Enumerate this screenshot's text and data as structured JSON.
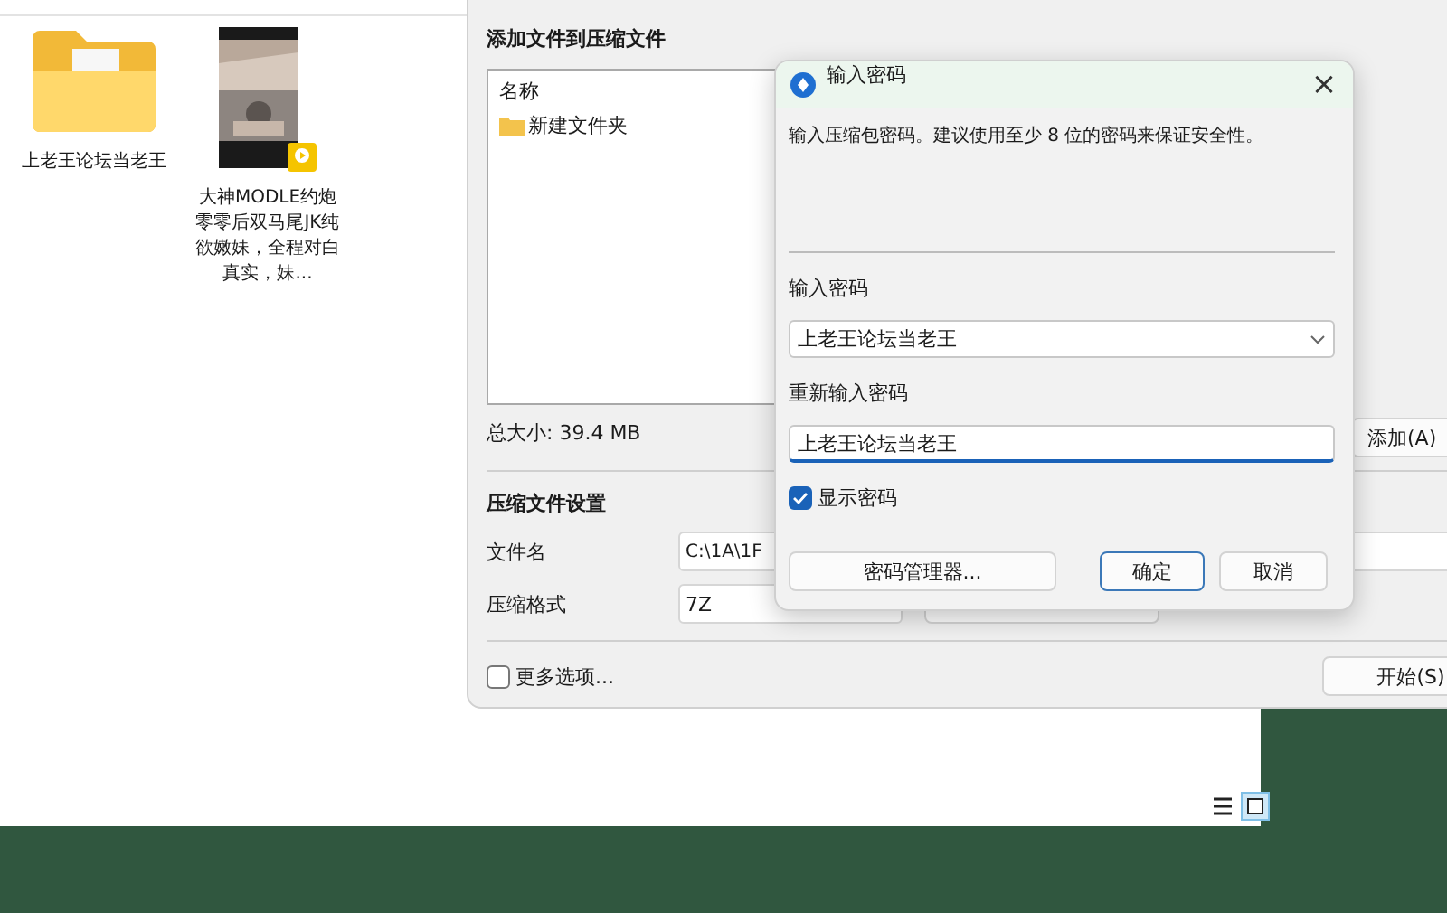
{
  "desktop": {
    "items": [
      {
        "kind": "folder",
        "label": "上老王论坛当老王"
      },
      {
        "kind": "video",
        "label": "大神MODLE约炮零零后双马尾JK纯欲嫩妹，全程对白真实，妹..."
      }
    ]
  },
  "compress_window": {
    "title": "添加文件到压缩文件",
    "list": {
      "column": "名称",
      "rows": [
        {
          "name": "新建文件夹"
        }
      ]
    },
    "total_size": "总大小: 39.4 MB",
    "add_button": "添加(A)",
    "settings_title": "压缩文件设置",
    "file_name": {
      "label": "文件名",
      "value": "C:\\1A\\1F"
    },
    "format": {
      "label": "压缩格式",
      "value": "7Z"
    },
    "more_options": {
      "label": "更多选项...",
      "checked": false
    },
    "start_button": "开始(S)"
  },
  "password_dialog": {
    "title": "输入密码",
    "close": "×",
    "hint": "输入压缩包密码。建议使用至少 8 位的密码来保证安全性。",
    "password": {
      "label": "输入密码",
      "value": "上老王论坛当老王"
    },
    "confirm": {
      "label": "重新输入密码",
      "value": "上老王论坛当老王"
    },
    "show_password": {
      "label": "显示密码",
      "checked": true
    },
    "buttons": [
      {
        "kind": "manager",
        "label": "密码管理器..."
      },
      {
        "kind": "ok",
        "label": "确定"
      },
      {
        "kind": "cancel",
        "label": "取消"
      }
    ]
  }
}
